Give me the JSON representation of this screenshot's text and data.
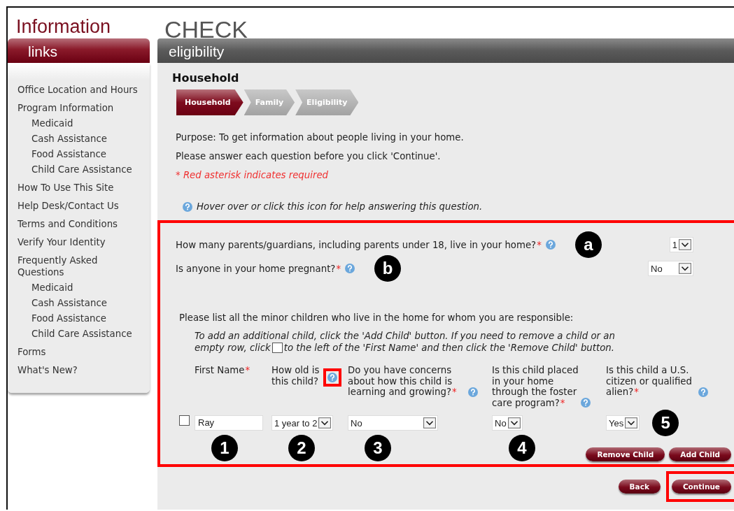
{
  "page": {
    "title": "Information",
    "subtitle": "CHECK"
  },
  "sidebar": {
    "header": "links",
    "items": [
      {
        "label": "Office Location and Hours"
      },
      {
        "label": "Program Information",
        "children": [
          {
            "label": "Medicaid"
          },
          {
            "label": "Cash Assistance"
          },
          {
            "label": "Food Assistance"
          },
          {
            "label": "Child Care Assistance"
          }
        ]
      },
      {
        "label": "How To Use This Site"
      },
      {
        "label": "Help Desk/Contact Us"
      },
      {
        "label": "Terms and Conditions"
      },
      {
        "label": "Verify Your Identity"
      },
      {
        "label": "Frequently Asked Questions",
        "children": [
          {
            "label": "Medicaid"
          },
          {
            "label": "Cash Assistance"
          },
          {
            "label": "Food Assistance"
          },
          {
            "label": "Child Care Assistance"
          }
        ]
      },
      {
        "label": "Forms"
      },
      {
        "label": "What's New?"
      }
    ]
  },
  "main": {
    "header": "eligibility",
    "heading": "Household",
    "steps": [
      {
        "label": "Household",
        "selected": true
      },
      {
        "label": "Family",
        "selected": false
      },
      {
        "label": "Eligibility",
        "selected": false
      }
    ],
    "intro": [
      "Purpose: To get information about people living in your home.",
      "Please answer each question before you click 'Continue'."
    ],
    "required_note": "* Red asterisk indicates required",
    "help_note": "Hover over or click this icon for help answering this question.",
    "questions_section": {
      "highlighted": true,
      "questions": [
        {
          "label": "How many parents/guardians, including parents under 18, live in your home?",
          "required_mark": "*",
          "value": "1",
          "marker": "a"
        },
        {
          "label": "Is anyone in your home pregnant?",
          "required_mark": "*",
          "value": "No",
          "marker": "b"
        }
      ],
      "children_intro": "Please list all the minor children who live in the home for whom you are responsible:",
      "instructions_line": "To add an additional child, click the 'Add Child' button. If you need to remove a child or an",
      "instructions_before": "empty row, click",
      "instructions_after": "to the left of the 'First Name' and then click the 'Remove Child' button.",
      "columns": [
        {
          "label": "First Name",
          "required_mark": "*",
          "help": false,
          "highlighted": false
        },
        {
          "label": "How old is this child?",
          "help": true,
          "highlighted": true
        },
        {
          "label": "Do you have concerns about how this child is learning and growing?",
          "required_mark": "*",
          "help": true,
          "highlighted": false
        },
        {
          "label": "Is this child placed in your home through the foster care program?",
          "required_mark": "*",
          "help": true,
          "highlighted": false
        },
        {
          "label": "Is this child a U.S. citizen or qualified alien?",
          "required_mark": "*",
          "help": true,
          "highlighted": false
        }
      ],
      "rows": [
        {
          "checked": false,
          "cells": [
            {
              "kind": "text",
              "value": "Ray",
              "marker": "1"
            },
            {
              "kind": "select",
              "value": "1 year to 2",
              "marker": "2"
            },
            {
              "kind": "select",
              "value": "No",
              "marker": "3"
            },
            {
              "kind": "select",
              "value": "No",
              "marker": "4"
            },
            {
              "kind": "select",
              "value": "Yes",
              "marker": "5"
            }
          ]
        }
      ],
      "buttons": [
        {
          "label": "Remove Child"
        },
        {
          "label": "Add Child"
        }
      ]
    },
    "nav_buttons": [
      {
        "label": "Back",
        "highlighted": false
      },
      {
        "label": "Continue",
        "highlighted": true
      }
    ]
  }
}
